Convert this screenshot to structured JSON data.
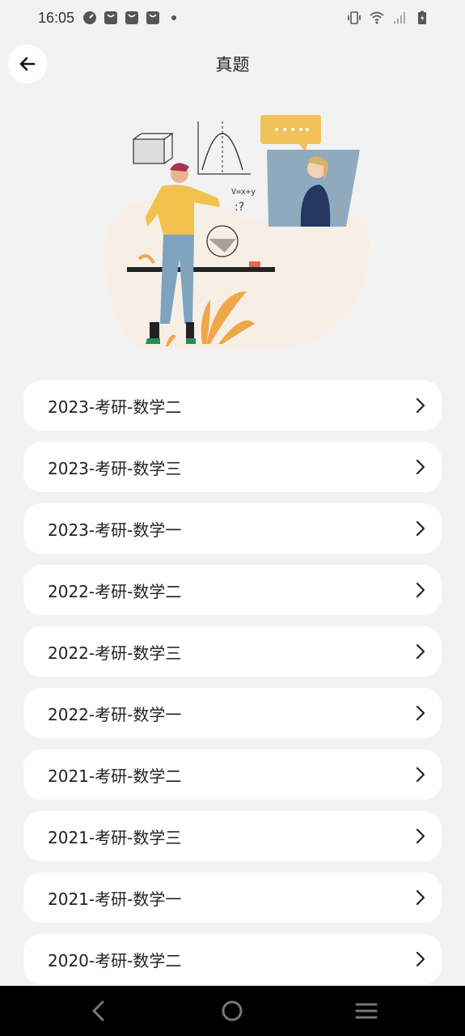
{
  "status_bar": {
    "time": "16:05",
    "left_icons": [
      "speedometer-icon",
      "bag-icon",
      "bag-icon",
      "bag-icon",
      "dot-icon"
    ],
    "right_icons": [
      "vibrate-icon",
      "wifi-icon",
      "signal-icon",
      "battery-charging-icon"
    ]
  },
  "header": {
    "back_icon": "arrow-left-icon",
    "title": "真题"
  },
  "illustration": {
    "icon": "teacher-whiteboard-illustration"
  },
  "exam_list": {
    "items": [
      {
        "label": "2023-考研-数学二"
      },
      {
        "label": "2023-考研-数学三"
      },
      {
        "label": "2023-考研-数学一"
      },
      {
        "label": "2022-考研-数学二"
      },
      {
        "label": "2022-考研-数学三"
      },
      {
        "label": "2022-考研-数学一"
      },
      {
        "label": "2021-考研-数学二"
      },
      {
        "label": "2021-考研-数学三"
      },
      {
        "label": "2021-考研-数学一"
      },
      {
        "label": "2020-考研-数学二"
      }
    ]
  },
  "nav_bar": {
    "icons": [
      "back-triangle-icon",
      "home-circle-icon",
      "menu-lines-icon"
    ]
  }
}
